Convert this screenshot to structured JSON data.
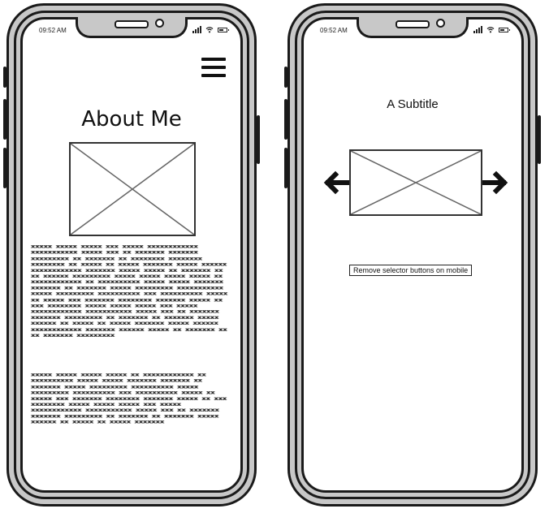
{
  "left_phone": {
    "status_time": "09:52 AM",
    "title": "About Me",
    "paragraph_1": "xxxxx xxxxx xxxxx xxx xxxxx xxxxxxxxxxxx xxxxxxxxxxx xxxxx xxx xx xxxxxxx xxxxxxx xxxxxxxxx xx xxxxxxx xx xxxxxxxx xxxxxxxx xxxxxxxx xx xxxxx xx xxxxx xxxxxxx xxxxx xxxxxx xxxxxxxxxxxx xxxxxxx xxxxx xxxxx xx xxxxxxx xx xx xxxxxx xxxxxxxxx xxxxx xxxxx xxxxx xxxxx xx xxxxxxxxxxxx xx xxxxxxxxxx xxxxx xxxxx xxxxxxx xxxxxxx xx xxxxxxx xxxxx xxxxxxxxx xxxxxxxxxxx xxxxx xxxxxxxxx xxxxxxxxxx xxx xxxxxxxxxx xxxxx xx xxxxx xxx xxxxxxx xxxxxxxx xxxxxxx xxxxx xx xxx xxxxxxxx xxxxx xxxxx xxxxx xxx xxxxx xxxxxxxxxxxx xxxxxxxxxxx xxxxx xxx xx xxxxxxx xxxxxxx xxxxxxxxx xx xxxxxxx xx xxxxxxx xxxxx xxxxxx xx xxxxx xx xxxxx xxxxxxx xxxxx xxxxxx xxxxxxxxxxxx xxxxxxx xxxxxx xxxxx xx xxxxxxx xx xx xxxxxxx xxxxxxxxx",
    "paragraph_2": "xxxxx xxxxx xxxxx xxxxx xx xxxxxxxxxxxx xx xxxxxxxxxx xxxxx xxxxx xxxxxxx xxxxxxx xx xxxxxxx xxxxx xxxxxxxxx xxxxxxxxxx xxxxx xxxxxxxxx xxxxxxxxxx xxx xxxxxxxxxx xxxxx xx xxxxx xxx xxxxxxx xxxxxxxx xxxxxxx xxxxx xx xxx xxxxxxxx xxxxx xxxxx xxxxx xxx xxxxx xxxxxxxxxxxx xxxxxxxxxxx xxxxx xxx xx xxxxxxx xxxxxxx xxxxxxxxx xx xxxxxxx xx xxxxxxx xxxxx xxxxxx xx xxxxx xx xxxxx xxxxxxx"
  },
  "right_phone": {
    "status_time": "09:52 AM",
    "subtitle": "A Subtitle",
    "note": "Remove selector buttons on mobile"
  },
  "icons": {
    "menu": "hamburger-icon",
    "previous": "arrow-left-icon",
    "next": "arrow-right-icon"
  }
}
